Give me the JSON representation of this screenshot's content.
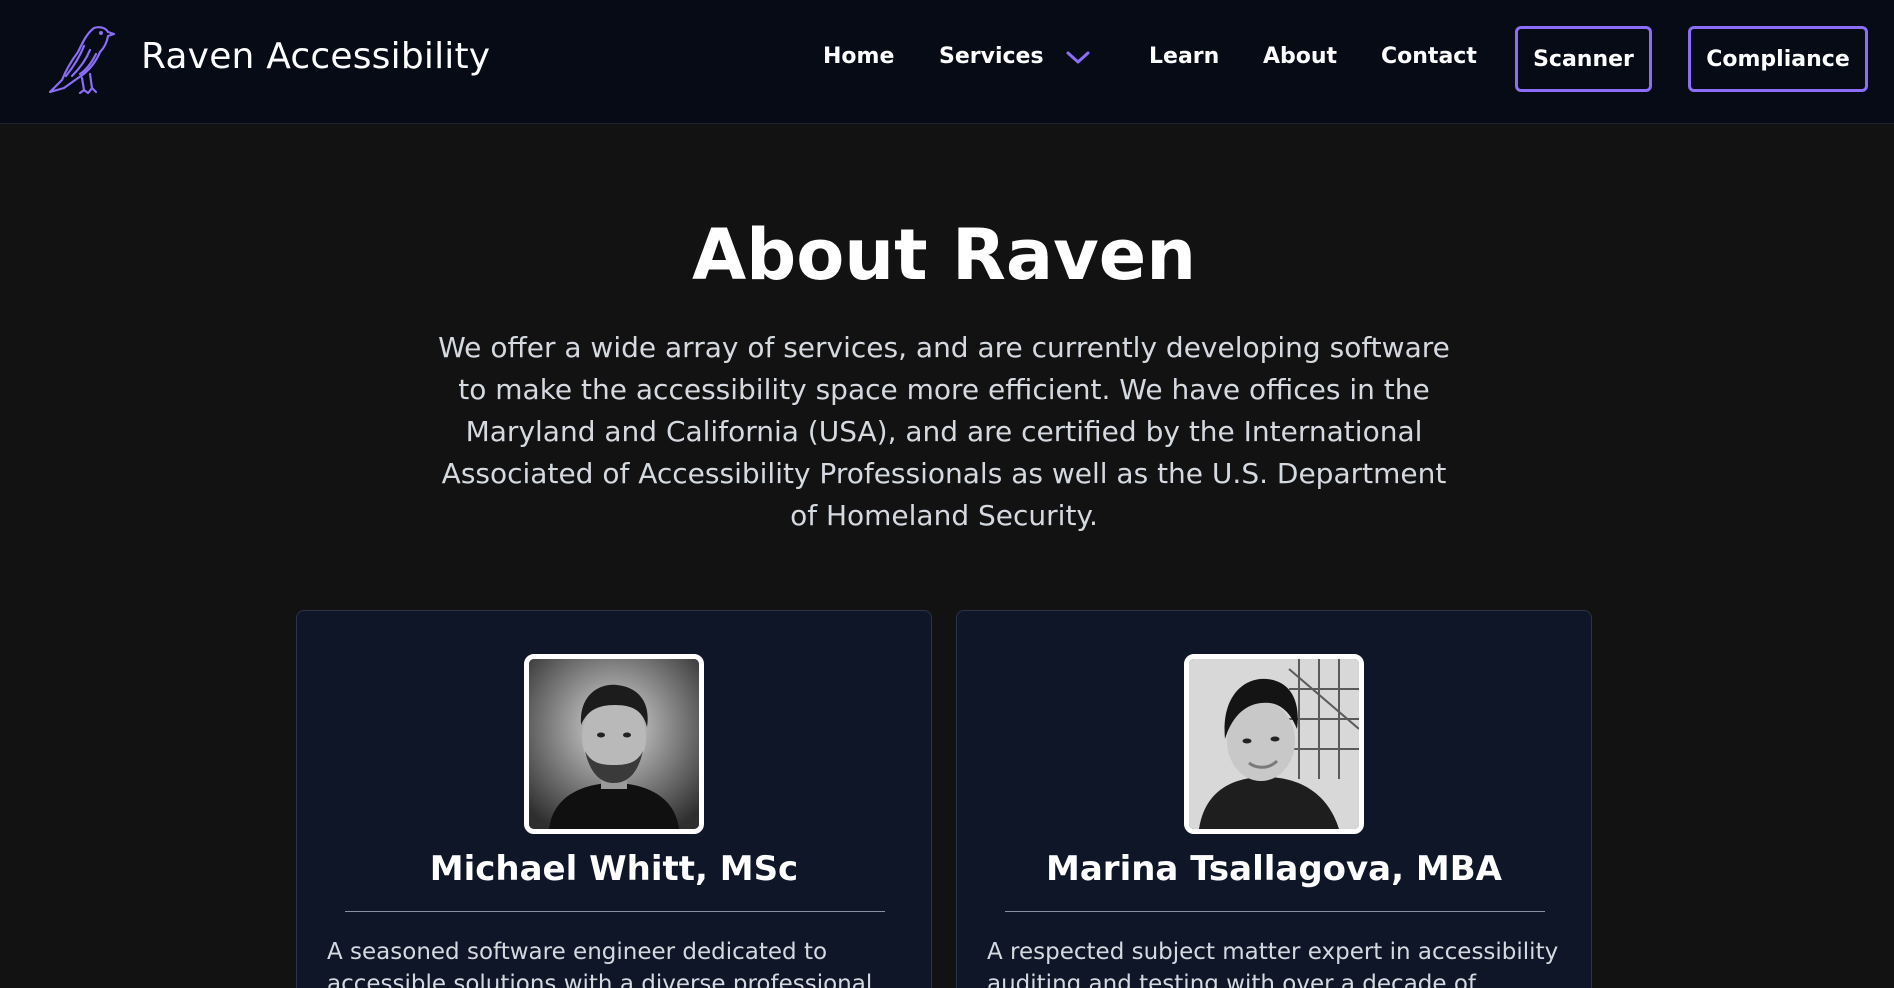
{
  "brand": {
    "name": "Raven Accessibility",
    "logo_icon": "raven-icon"
  },
  "nav": {
    "home": "Home",
    "services": "Services",
    "learn": "Learn",
    "about": "About",
    "contact": "Contact",
    "scanner": "Scanner",
    "compliance": "Compliance"
  },
  "hero": {
    "title": "About Raven",
    "intro": "We offer a wide array of services, and are currently developing software to make the accessibility space more efficient. We have offices in the Maryland and California (USA), and are certified by the International Associated of Accessibility Professionals as well as the U.S. Department of Homeland Security."
  },
  "team": [
    {
      "name": "Michael Whitt, MSc",
      "bio": "A seasoned software engineer dedicated to accessible solutions with a diverse professional"
    },
    {
      "name": "Marina Tsallagova, MBA",
      "bio": "A respected subject matter expert in accessibility auditing and testing with over a decade of experience"
    }
  ],
  "colors": {
    "background": "#121212",
    "header": "#070b16",
    "card": "#0e1628",
    "accent": "#8b6df7"
  }
}
